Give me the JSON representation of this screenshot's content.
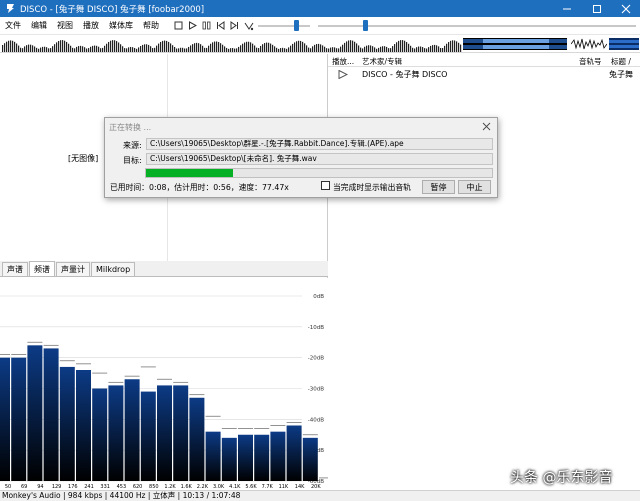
{
  "window": {
    "title": "DISCO - [兔子舞 DISCO] 兔子舞  [foobar2000]"
  },
  "menu": {
    "items": [
      "文件",
      "编辑",
      "视图",
      "播放",
      "媒体库",
      "帮助"
    ]
  },
  "seek": {
    "position": 0.125,
    "volume": 0.35
  },
  "left": {
    "no_image": "[无图像]",
    "tabs": [
      "声谱",
      "频谱",
      "声量计",
      "Milkdrop"
    ],
    "active_tab": 1
  },
  "spectrum": {
    "bg_color": "#ffffff",
    "bar_top": "#0c3b86",
    "bar_bottom": "#000000",
    "db_labels": [
      "0dB",
      "-10dB",
      "-20dB",
      "-30dB",
      "-40dB",
      "-50dB",
      "-60dB"
    ],
    "freq_labels": [
      "50",
      "69",
      "94",
      "129",
      "176",
      "241",
      "331",
      "453",
      "620",
      "850",
      "1.2K",
      "1.6K",
      "2.2K",
      "3.0K",
      "4.1K",
      "5.6K",
      "7.7K",
      "11K",
      "14K",
      "20K"
    ],
    "bars_db": [
      -20,
      -20,
      -16,
      -17,
      -23,
      -24,
      -30,
      -29,
      -27,
      -31,
      -29,
      -29,
      -33,
      -44,
      -46,
      -45,
      -45,
      -44,
      -42,
      -46,
      -60
    ],
    "peaks_db": [
      -19,
      -19,
      -15,
      -16,
      -21,
      -22,
      -25,
      -28,
      -26,
      -23,
      -27,
      -28,
      -32,
      -39,
      -43,
      -43,
      -43,
      -42,
      -41,
      -45,
      -59
    ]
  },
  "playlist": {
    "headers": [
      "播放...",
      "艺术家/专辑",
      "音轨号",
      "标题 /"
    ],
    "rows": [
      {
        "artist_album": "DISCO - 兔子舞 DISCO",
        "track": "",
        "title": "兔子舞"
      }
    ]
  },
  "dialog": {
    "title": "正在转换 ...",
    "source_label": "来源:",
    "source_path": "C:\\Users\\19065\\Desktop\\群星.-.[兔子舞.Rabbit.Dance].专辑.(APE).ape",
    "target_label": "目标:",
    "target_path": "C:\\Users\\19065\\Desktop\\[未命名]. 兔子舞.wav",
    "progress": 0.25,
    "status": "已用时间：0:08，估计用时：0:56，速度：77.47x",
    "checkbox_label": "当完成时显示输出音轨",
    "checkbox_checked": false,
    "pause_label": "暂停",
    "cancel_label": "中止"
  },
  "statusbar": {
    "text": "Monkey's Audio | 984 kbps | 44100 Hz | 立体声 | 10:13 / 1:07:48"
  },
  "watermark": "头条 @乐东影音"
}
